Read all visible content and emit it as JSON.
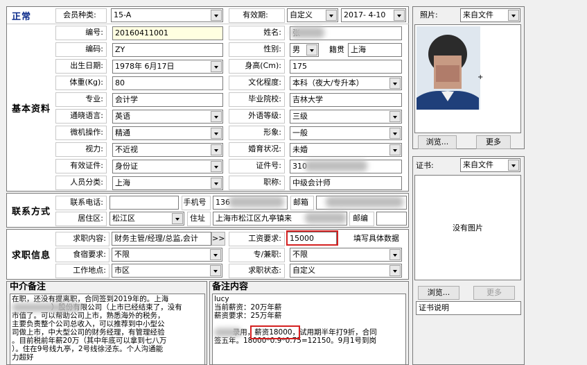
{
  "header": {
    "status_label": "正常"
  },
  "member": {
    "type_label": "会员种类:",
    "type_value": "15-A",
    "valid_label": "有效期:",
    "valid_mode": "自定义",
    "valid_date": "2017- 4-10"
  },
  "basic": {
    "section_title": "基本资料",
    "id_label": "编号:",
    "id_value": "20160411001",
    "name_label": "姓名:",
    "name_value": "张",
    "code_label": "编码:",
    "code_value": "ZY",
    "gender_label": "性别:",
    "gender_value": "男",
    "hometown_label": "籍贯",
    "hometown_value": "上海",
    "birth_label": "出生日期:",
    "birth_value": "1978年 6月17日",
    "height_label": "身高(Cm):",
    "height_value": "175",
    "weight_label": "体重(Kg):",
    "weight_value": "80",
    "education_label": "文化程度:",
    "education_value": "本科（夜大/专升本）",
    "major_label": "专业:",
    "major_value": "会计学",
    "school_label": "毕业院校:",
    "school_value": "吉林大学",
    "language_label": "通晓语言:",
    "language_value": "英语",
    "lang_level_label": "外语等级:",
    "lang_level_value": "三级",
    "computer_label": "微机操作:",
    "computer_value": "精通",
    "image_label": "形象:",
    "image_value": "一般",
    "vision_label": "视力:",
    "vision_value": "不近视",
    "marital_label": "婚育状况:",
    "marital_value": "未婚",
    "doc_label": "有效证件:",
    "doc_value": "身份证",
    "docno_label": "证件号:",
    "docno_value": "310",
    "category_label": "人员分类:",
    "category_value": "上海",
    "title_label": "职称:",
    "title_value": "中级会计师"
  },
  "contact": {
    "section_title": "联系方式",
    "phone_label": "联系电话:",
    "phone_value": "",
    "mobile_label": "手机号",
    "mobile_value": "136",
    "email_label": "邮箱",
    "district_label": "居住区:",
    "district_value": "松江区",
    "address_label": "住址",
    "address_value": "上海市松江区九亭镇来",
    "postcode_label": "邮编"
  },
  "job": {
    "section_title": "求职信息",
    "content_label": "求职内容:",
    "content_value": "财务主管/经理/总监,会计",
    "more_label": ">>",
    "salary_label": "工资要求:",
    "salary_value": "15000",
    "salary_hint": "填写具体数据",
    "board_label": "食宿要求:",
    "board_value": "不限",
    "parttime_label": "专/兼职:",
    "parttime_value": "不限",
    "location_label": "工作地点:",
    "location_value": "市区",
    "status_label": "求职状态:",
    "status_value": "自定义"
  },
  "agency_notes": {
    "title": "中介备注",
    "lines": [
      "在职，还没有提离职，合同签到2019年的。上海",
      "                 ）股份有限公司（上市已经结束了，没有",
      "市值了。可以帮助公司上市，熟悉海外的税务，",
      "主要负责整个公司总收入，可以推荐到中小型公",
      "司做上市，中大型公司的财务经理，有管理经验",
      "。目前税前年薪20万（其中年底可以拿到七八万",
      "）。住在9号线九亭，2号线徐泾东。个人沟通能",
      "力超好"
    ]
  },
  "remarks": {
    "title": "备注内容",
    "lines": [
      "lucy",
      "当前薪资：20万年薪",
      "薪资要求：25万年薪",
      "",
      "        录用，薪资18000，试用期半年打9折，合同",
      "签五年。18000*0.9*0.75=12150。9月1号到岗"
    ],
    "highlight": "薪资18000，"
  },
  "photo": {
    "label": "照片:",
    "source": "来自文件",
    "browse_label": "浏览...",
    "more_label": "更多"
  },
  "certificate": {
    "label": "证书:",
    "source": "来自文件",
    "no_image": "没有图片",
    "browse_label": "浏览...",
    "more_label": "更多",
    "desc_label": "证书说明"
  }
}
